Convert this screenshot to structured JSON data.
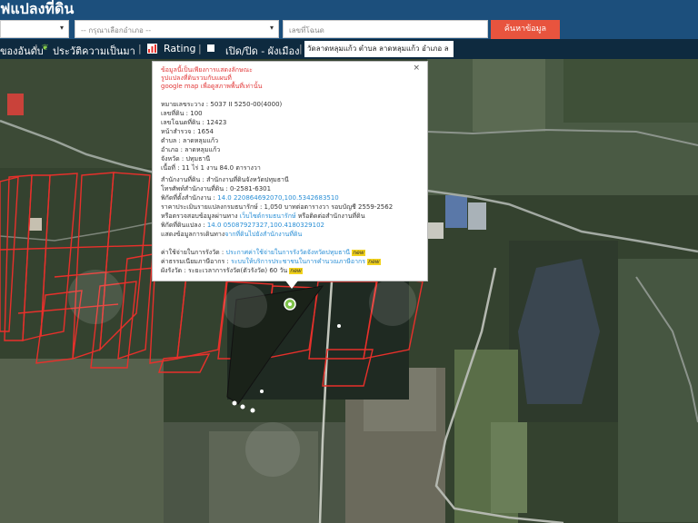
{
  "header": {
    "title": "ฟแปลงที่ดิน",
    "province_select": "",
    "district_select": "-- กรุณาเลือกอำเภอ --",
    "parcel_input_placeholder": "เลขที่โฉนด",
    "search_button": "ค้นหาข้อมูล"
  },
  "toolbar": {
    "item_rank": "ของอันดับ",
    "item_history": "ประวัติความเป็นมา",
    "item_rating": "Rating",
    "item_toggle": "เปิด/ปิด - ผังเมือง",
    "location_value": "วัดลาดหลุมแก้ว ตำบล ลาดหลุมแก้ว อำเภอ ล"
  },
  "popup": {
    "notice_line1": "ข้อมูลนี้เป็นเพียงการแสดงลักษณะ",
    "notice_line2": "รูปแปลงที่ดินรวมกับแผนที่",
    "notice_line3": "google map เพื่อดูสภาพพื้นที่เท่านั้น",
    "survey_label": "หมายเลขระวาง :",
    "survey_value": "5037 II 5250-00(4000)",
    "land_no_label": "เลขที่ดิน :",
    "land_no_value": "100",
    "deed_label": "เลขโฉนดที่ดิน :",
    "deed_value": "12423",
    "page_label": "หน้าสำรวจ :",
    "page_value": "1654",
    "subdistrict_label": "ตำบล :",
    "subdistrict_value": "ลาดหลุมแก้ว",
    "district_label": "อำเภอ :",
    "district_value": "ลาดหลุมแก้ว",
    "province_label": "จังหวัด :",
    "province_value": "ปทุมธานี",
    "area_label": "เนื้อที่ :",
    "area_value": "11 ไร่ 1 งาน 84.0 ตารางวา",
    "office_label": "สำนักงานที่ดิน :",
    "office_value": "สำนักงานที่ดินจังหวัดปทุมธานี",
    "phone_label": "โทรศัพท์สำนักงานที่ดิน :",
    "phone_value": "0-2581-6301",
    "office_coord_label": "พิกัดที่ตั้งสำนักงาน :",
    "office_coord_value": "14.0 220864692070,100.5342683510",
    "price_label": "ราคาประเมินรายแปลงกรมธนารักษ์ :",
    "price_value": "1,050 บาทต่อตารางวา รอบบัญชี 2559-2562",
    "check_text": "หรือตรวจสอบข้อมูลผ่านทาง",
    "check_link": "เว็บไซต์กรมธนารักษ์",
    "check_suffix": "หรือติดต่อสำนักงานที่ดิน",
    "parcel_coord_label": "พิกัดที่ดินแปลง :",
    "parcel_coord_value": "14.0 05087927327,100.4180329102",
    "route_text": "แสดงข้อมูลการเดินทาง",
    "route_link": "จากที่ดินไปยังสำนักงานที่ดิน",
    "fee_label": "ค่าใช้จ่ายในการรังวัด :",
    "fee_link": "ประกาศค่าใช้จ่ายในการรังวัดจังหวัดปทุมธานี",
    "new_badge": "new",
    "tax_label": "ค่าธรรมเนียมภาษีอากร :",
    "tax_link": "ระบบให้บริการประชาชนในการคำนวณภาษีอากร",
    "duration_label": "ผังรังวัด :",
    "duration_value": "ระยะเวลาการรังวัด(ตัวรังวัด) 60 วัน",
    "close_icon": "×"
  },
  "colors": {
    "header_bg": "#1c4f7c",
    "toolbar_bg": "#0e2a3f",
    "search_button": "#e8543e",
    "parcel_outline": "#e8302b",
    "popup_red_text": "#e23a3a",
    "link_blue": "#2a8fd6"
  },
  "icons": [
    "caret-down-icon",
    "leaf-icon",
    "chart-icon",
    "square-icon",
    "close-icon",
    "map-marker-icon"
  ]
}
